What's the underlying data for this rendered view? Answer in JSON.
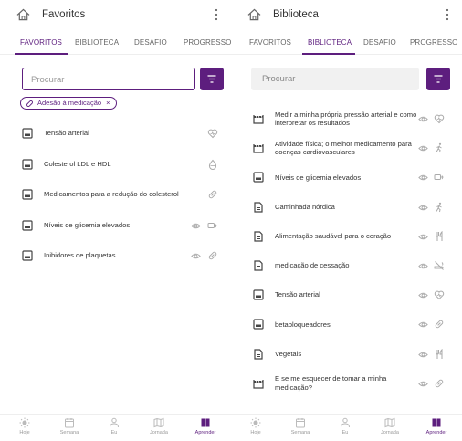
{
  "colors": {
    "accent": "#5d1e7e",
    "text": "#333333",
    "muted": "#999999",
    "icon": "#aaaaaa"
  },
  "screens": [
    {
      "id": "left",
      "header": {
        "title": "Favoritos"
      },
      "tabs": [
        {
          "label": "FAVORITOS",
          "active": true
        },
        {
          "label": "BIBLIOTECA",
          "active": false
        },
        {
          "label": "DESAFIO",
          "active": false
        },
        {
          "label": "PROGRESSO",
          "active": false
        }
      ],
      "search": {
        "placeholder": "Procurar"
      },
      "filter_chip": {
        "label": "Adesão à medicação",
        "close": "×"
      },
      "items": [
        {
          "lead_icon": "image-icon",
          "label": "Tensão arterial",
          "eye": false,
          "trail_icon": "heart-icon"
        },
        {
          "lead_icon": "image-icon",
          "label": "Colesterol LDL e HDL",
          "eye": false,
          "trail_icon": "droplet-icon"
        },
        {
          "lead_icon": "image-icon",
          "label": "Medicamentos para a redução do colesterol",
          "eye": false,
          "trail_icon": "pill-icon"
        },
        {
          "lead_icon": "image-icon",
          "label": "Níveis de glicemia elevados",
          "eye": true,
          "trail_icon": "glucose-icon"
        },
        {
          "lead_icon": "image-icon",
          "label": "Inibidores de plaquetas",
          "eye": true,
          "trail_icon": "pill-icon"
        }
      ]
    },
    {
      "id": "right",
      "header": {
        "title": "Biblioteca"
      },
      "tabs": [
        {
          "label": "FAVORITOS",
          "active": false
        },
        {
          "label": "BIBLIOTECA",
          "active": true
        },
        {
          "label": "DESAFIO",
          "active": false
        },
        {
          "label": "PROGRESSO",
          "active": false
        }
      ],
      "search": {
        "placeholder": "Procurar"
      },
      "items": [
        {
          "lead_icon": "video-icon",
          "label": "Medir a minha própria pressão arterial e como interpretar os resultados",
          "eye": true,
          "trail_icon": "heart-icon"
        },
        {
          "lead_icon": "video-icon",
          "label": "Atividade física; o melhor medicamento para doenças cardiovasculares",
          "eye": true,
          "trail_icon": "running-icon"
        },
        {
          "lead_icon": "image-icon",
          "label": "Níveis de glicemia elevados",
          "eye": true,
          "trail_icon": "glucose-icon"
        },
        {
          "lead_icon": "document-icon",
          "label": "Caminhada nórdica",
          "eye": true,
          "trail_icon": "running-icon"
        },
        {
          "lead_icon": "document-icon",
          "label": "Alimentação saudável para o coração",
          "eye": true,
          "trail_icon": "fork-knife-icon"
        },
        {
          "lead_icon": "document-icon",
          "label": "medicação de cessação",
          "eye": true,
          "trail_icon": "no-smoking-icon"
        },
        {
          "lead_icon": "image-icon",
          "label": "Tensão arterial",
          "eye": true,
          "trail_icon": "heart-icon"
        },
        {
          "lead_icon": "image-icon",
          "label": "betabloqueadores",
          "eye": true,
          "trail_icon": "pill-icon"
        },
        {
          "lead_icon": "document-icon",
          "label": "Vegetais",
          "eye": true,
          "trail_icon": "fork-knife-icon"
        },
        {
          "lead_icon": "video-icon",
          "label": "E se me esquecer de tomar a minha medicação?",
          "eye": true,
          "trail_icon": "pill-icon"
        }
      ]
    }
  ],
  "bottom_nav": [
    {
      "icon": "sun-icon",
      "label": "Hoje",
      "active": false
    },
    {
      "icon": "calendar-icon",
      "label": "Semana",
      "active": false
    },
    {
      "icon": "person-icon",
      "label": "Eu",
      "active": false
    },
    {
      "icon": "map-icon",
      "label": "Jornada",
      "active": false
    },
    {
      "icon": "book-icon",
      "label": "Aprender",
      "active": true
    }
  ]
}
